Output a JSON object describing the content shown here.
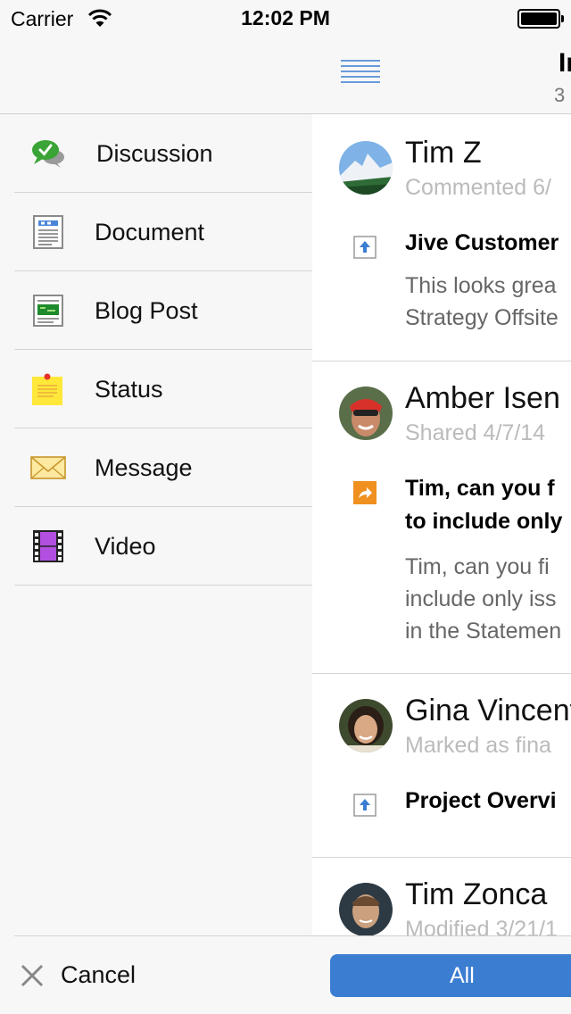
{
  "status_bar": {
    "carrier": "Carrier",
    "time": "12:02 PM"
  },
  "drawer": {
    "items": [
      {
        "label": "Discussion",
        "icon": "discussion-icon"
      },
      {
        "label": "Document",
        "icon": "document-icon"
      },
      {
        "label": "Blog Post",
        "icon": "blog-post-icon"
      },
      {
        "label": "Status",
        "icon": "status-note-icon"
      },
      {
        "label": "Message",
        "icon": "envelope-icon"
      },
      {
        "label": "Video",
        "icon": "film-icon"
      }
    ],
    "cancel_label": "Cancel"
  },
  "main": {
    "nav_title": "In",
    "nav_subtitle": "3",
    "feed": [
      {
        "author": "Tim Z",
        "meta": "Commented 6/",
        "type_icon": "document-upload-icon",
        "title": [
          "Jive Customer"
        ],
        "body": [
          "This looks grea",
          "Strategy Offsite"
        ]
      },
      {
        "author": "Amber Isen",
        "meta": "Shared 4/7/14",
        "type_icon": "share-arrow-icon",
        "title": [
          "Tim, can you f",
          "to include only"
        ],
        "body": [
          "Tim, can you fi",
          "include only iss",
          "in the Statemen"
        ]
      },
      {
        "author": "Gina Vincent",
        "meta": "Marked as fina",
        "type_icon": "document-upload-icon",
        "title": [
          "Project Overvi"
        ],
        "body": []
      },
      {
        "author": "Tim Zonca",
        "meta": "Modified 3/21/1",
        "type_icon": "",
        "title": [],
        "body": []
      }
    ],
    "filter_all_label": "All"
  },
  "colors": {
    "accent": "#3a7dd1",
    "share": "#f0901e",
    "discussion": "#3aa536",
    "status_note": "#ffe83a",
    "video": "#b24ee0"
  }
}
